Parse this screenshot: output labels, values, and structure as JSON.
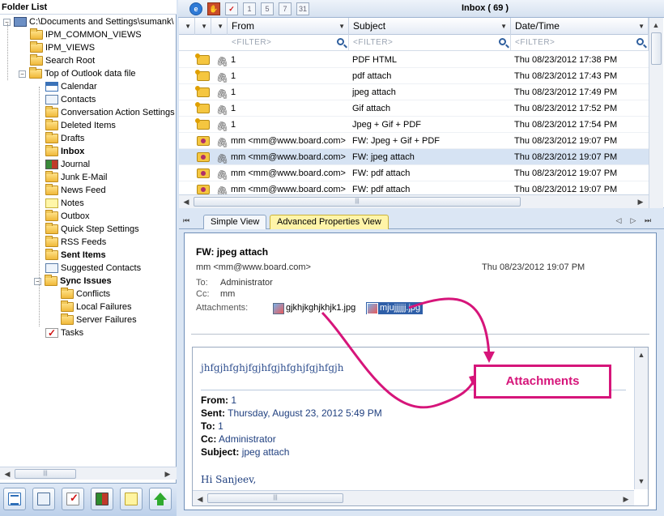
{
  "folder_pane": {
    "title": "Folder List",
    "items": [
      {
        "label": "C:\\Documents and Settings\\sumank\\",
        "icon": "computer-icon",
        "bold": false
      },
      {
        "label": "IPM_COMMON_VIEWS",
        "icon": "folder-icon",
        "bold": false
      },
      {
        "label": "IPM_VIEWS",
        "icon": "folder-icon",
        "bold": false
      },
      {
        "label": "Search Root",
        "icon": "folder-icon",
        "bold": false
      },
      {
        "label": "Top of Outlook data file",
        "icon": "folder-icon",
        "bold": false
      },
      {
        "label": "Calendar",
        "icon": "calendar-icon",
        "bold": false
      },
      {
        "label": "Contacts",
        "icon": "contacts-icon",
        "bold": false
      },
      {
        "label": "Conversation Action Settings",
        "icon": "folder-icon",
        "bold": false
      },
      {
        "label": "Deleted Items",
        "icon": "folder-icon",
        "bold": false
      },
      {
        "label": "Drafts",
        "icon": "folder-icon",
        "bold": false
      },
      {
        "label": "Inbox",
        "icon": "folder-icon",
        "bold": true
      },
      {
        "label": "Journal",
        "icon": "journal-icon",
        "bold": false
      },
      {
        "label": "Junk E-Mail",
        "icon": "folder-icon",
        "bold": false
      },
      {
        "label": "News Feed",
        "icon": "folder-icon",
        "bold": false
      },
      {
        "label": "Notes",
        "icon": "notes-icon",
        "bold": false
      },
      {
        "label": "Outbox",
        "icon": "folder-icon",
        "bold": false
      },
      {
        "label": "Quick Step Settings",
        "icon": "folder-icon",
        "bold": false
      },
      {
        "label": "RSS Feeds",
        "icon": "folder-icon",
        "bold": false
      },
      {
        "label": "Sent Items",
        "icon": "folder-icon",
        "bold": true
      },
      {
        "label": "Suggested Contacts",
        "icon": "contacts-icon",
        "bold": false
      },
      {
        "label": "Sync Issues",
        "icon": "folder-icon",
        "bold": true
      },
      {
        "label": "Conflicts",
        "icon": "folder-icon",
        "bold": false
      },
      {
        "label": "Local Failures",
        "icon": "folder-icon",
        "bold": false
      },
      {
        "label": "Server Failures",
        "icon": "folder-icon",
        "bold": false
      },
      {
        "label": "Tasks",
        "icon": "tasks-icon",
        "bold": false
      }
    ],
    "nav_buttons": [
      "mail-icon",
      "contacts-icon",
      "tasks-icon",
      "journal-icon",
      "notes-icon",
      "up-arrow-icon"
    ]
  },
  "toolbar": {
    "inbox_title": "Inbox ( 69 )",
    "buttons": [
      {
        "icon": "refresh-icon",
        "text": "e"
      },
      {
        "icon": "delete-icon",
        "text": "✋"
      },
      {
        "icon": "checkmark-icon",
        "text": "✓"
      },
      {
        "icon": "day-view-icon",
        "text": "1"
      },
      {
        "icon": "week-5-view-icon",
        "text": "5"
      },
      {
        "icon": "week-7-view-icon",
        "text": "7"
      },
      {
        "icon": "month-view-icon",
        "text": "31"
      }
    ]
  },
  "message_list": {
    "columns": {
      "from": "From",
      "subject": "Subject",
      "date": "Date/Time"
    },
    "filter_placeholder": "<FILTER>",
    "rows": [
      {
        "from": "1",
        "subject": "PDF HTML",
        "date": "Thu 08/23/2012 17:38 PM",
        "kind": "read",
        "selected": false
      },
      {
        "from": "1",
        "subject": "pdf attach",
        "date": "Thu 08/23/2012 17:43 PM",
        "kind": "read",
        "selected": false
      },
      {
        "from": "1",
        "subject": "jpeg attach",
        "date": "Thu 08/23/2012 17:49 PM",
        "kind": "read",
        "selected": false
      },
      {
        "from": "1",
        "subject": "Gif attach",
        "date": "Thu 08/23/2012 17:52 PM",
        "kind": "read",
        "selected": false
      },
      {
        "from": "1",
        "subject": "Jpeg + Gif + PDF",
        "date": "Thu 08/23/2012 17:54 PM",
        "kind": "read",
        "selected": false
      },
      {
        "from": "mm <mm@www.board.com>",
        "subject": "FW: Jpeg + Gif + PDF",
        "date": "Thu 08/23/2012 19:07 PM",
        "kind": "forward",
        "selected": false
      },
      {
        "from": "mm <mm@www.board.com>",
        "subject": "FW: jpeg attach",
        "date": "Thu 08/23/2012 19:07 PM",
        "kind": "forward",
        "selected": true
      },
      {
        "from": "mm <mm@www.board.com>",
        "subject": "FW: pdf attach",
        "date": "Thu 08/23/2012 19:07 PM",
        "kind": "forward",
        "selected": false
      },
      {
        "from": "mm <mm@www.board.com>",
        "subject": "FW: pdf attach",
        "date": "Thu 08/23/2012 19:07 PM",
        "kind": "forward",
        "selected": false
      }
    ]
  },
  "tabs": [
    {
      "label": "Simple View",
      "active": false
    },
    {
      "label": "Advanced Properties View",
      "active": true
    }
  ],
  "preview": {
    "subject": "FW: jpeg attach",
    "from": "mm <mm@www.board.com>",
    "date": "Thu 08/23/2012 19:07 PM",
    "to_label": "To:",
    "to": "Administrator",
    "cc_label": "Cc:",
    "cc": "mm",
    "attachments_label": "Attachments:",
    "attachments": [
      "gjkhjkghjkhjk1.jpg",
      "mjujjjjjj.jpg"
    ],
    "body": {
      "first_line": "jhfgjhfghjfgjhfgjhfghjfgjhfgjh",
      "from_label": "From:",
      "from": "1",
      "sent_label": "Sent:",
      "sent": "Thursday, August 23, 2012 5:49 PM",
      "to_label": "To:",
      "to": "1",
      "cc_label": "Cc:",
      "cc": "Administrator",
      "subject_label": "Subject:",
      "subject": "jpeg attach",
      "greeting": "Hi Sanjeev,"
    }
  },
  "annotation": {
    "callout_text": "Attachments",
    "color": "#d6157a"
  }
}
